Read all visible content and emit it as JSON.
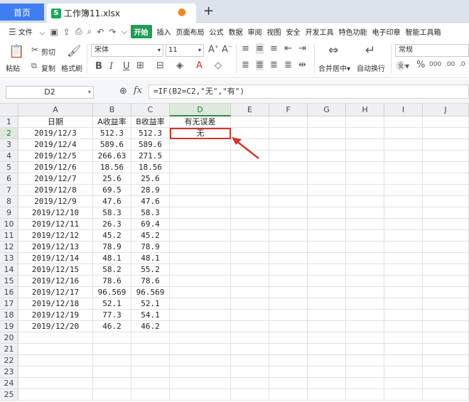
{
  "titlebar": {
    "home_tab": "首页",
    "file_tab": "工作簿11.xlsx",
    "file_icon": "S"
  },
  "menubar": {
    "file_menu": "文件",
    "items": [
      "开始",
      "插入",
      "页面布局",
      "公式",
      "数据",
      "审阅",
      "视图",
      "安全",
      "开发工具",
      "特色功能",
      "电子印章",
      "智能工具箱"
    ]
  },
  "toolbar": {
    "paste": "粘贴",
    "cut": "剪切",
    "copy": "复制",
    "format_painter": "格式刷",
    "font_name": "宋体",
    "font_size": "11",
    "merge": "合并居中",
    "wrap": "自动换行",
    "number_format": "常规"
  },
  "formula_bar": {
    "cell_ref": "D2",
    "fx": "fx",
    "formula": "=IF(B2=C2,\"无\",\"有\")"
  },
  "sheet": {
    "columns": [
      "A",
      "B",
      "C",
      "D",
      "E",
      "F",
      "G",
      "H",
      "I",
      "J"
    ],
    "headers": [
      "日期",
      "A收益率",
      "B收益率",
      "有无误差"
    ],
    "rows": [
      [
        "2019/12/3",
        "512.3",
        "512.3",
        "无"
      ],
      [
        "2019/12/4",
        "589.6",
        "589.6",
        ""
      ],
      [
        "2019/12/5",
        "266.63",
        "271.5",
        ""
      ],
      [
        "2019/12/6",
        "18.56",
        "18.56",
        ""
      ],
      [
        "2019/12/7",
        "25.6",
        "25.6",
        ""
      ],
      [
        "2019/12/8",
        "69.5",
        "28.9",
        ""
      ],
      [
        "2019/12/9",
        "47.6",
        "47.6",
        ""
      ],
      [
        "2019/12/10",
        "58.3",
        "58.3",
        ""
      ],
      [
        "2019/12/11",
        "26.3",
        "69.4",
        ""
      ],
      [
        "2019/12/12",
        "45.2",
        "45.2",
        ""
      ],
      [
        "2019/12/13",
        "78.9",
        "78.9",
        ""
      ],
      [
        "2019/12/14",
        "48.1",
        "48.1",
        ""
      ],
      [
        "2019/12/15",
        "58.2",
        "55.2",
        ""
      ],
      [
        "2019/12/16",
        "78.6",
        "78.6",
        ""
      ],
      [
        "2019/12/17",
        "96.569",
        "96.569",
        ""
      ],
      [
        "2019/12/18",
        "52.1",
        "52.1",
        ""
      ],
      [
        "2019/12/19",
        "77.3",
        "54.1",
        ""
      ],
      [
        "2019/12/20",
        "46.2",
        "46.2",
        ""
      ]
    ],
    "row_numbers": [
      "1",
      "2",
      "3",
      "4",
      "5",
      "6",
      "7",
      "8",
      "9",
      "10",
      "11",
      "12",
      "13",
      "14",
      "15",
      "16",
      "17",
      "18",
      "19",
      "20",
      "21",
      "22",
      "23",
      "24",
      "25"
    ],
    "selected_cell": "D2"
  },
  "colors": {
    "accent_green": "#1f9d55",
    "home_tab_blue": "#3f7df0",
    "highlight_red": "#d2352b"
  }
}
